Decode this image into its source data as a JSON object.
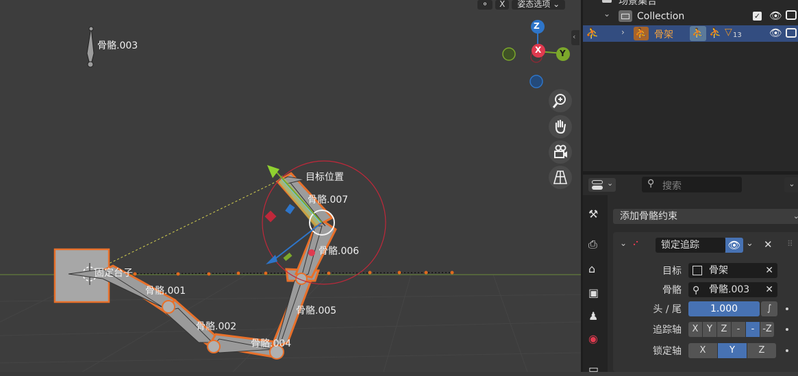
{
  "viewport": {
    "header": {
      "pose_options": "姿态选项",
      "x_button": "X"
    },
    "axes": {
      "z": "Z",
      "x": "X",
      "y": "Y"
    },
    "labels": {
      "bone_003": "骨骼.003",
      "target": "目标位置",
      "bone_007": "骨骼.007",
      "bone_006": "骨骼.006",
      "base": "固定台子",
      "bone_001": "骨骼.001",
      "bone_005": "骨骼.005",
      "bone_002": "骨骼.002",
      "bone_004": "骨骼.004"
    },
    "nav_icons": [
      "zoom-icon",
      "hand-pan-icon",
      "camera-icon",
      "grid-perspective-icon"
    ]
  },
  "outliner": {
    "scene_collection": "场景集合",
    "collection": "Collection",
    "armature": "骨架",
    "armature_count": "13"
  },
  "properties": {
    "search_placeholder": "搜索",
    "add_constraint": "添加骨骼约束",
    "constraint_name": "锁定追踪",
    "target_label": "目标",
    "target_value": "骨架",
    "bone_label": "骨骼",
    "bone_value": "骨骼.003",
    "head_tail_label": "头 / 尾",
    "head_tail_value": "1.000",
    "track_axis_label": "追踪轴",
    "track_axis_options": [
      "X",
      "Y",
      "Z",
      "-",
      "-",
      "-Z"
    ],
    "track_axis_selected": 4,
    "lock_axis_label": "锁定轴",
    "lock_axis_options": [
      "X",
      "Y",
      "Z"
    ],
    "lock_axis_selected": 1
  },
  "colors": {
    "accent": "#4772b3",
    "selection_outline": "#e8702a",
    "axis_x": "#e03a4f",
    "axis_y": "#7ca82b",
    "axis_z": "#2e75c9",
    "armature_orange": "#e8962a"
  }
}
